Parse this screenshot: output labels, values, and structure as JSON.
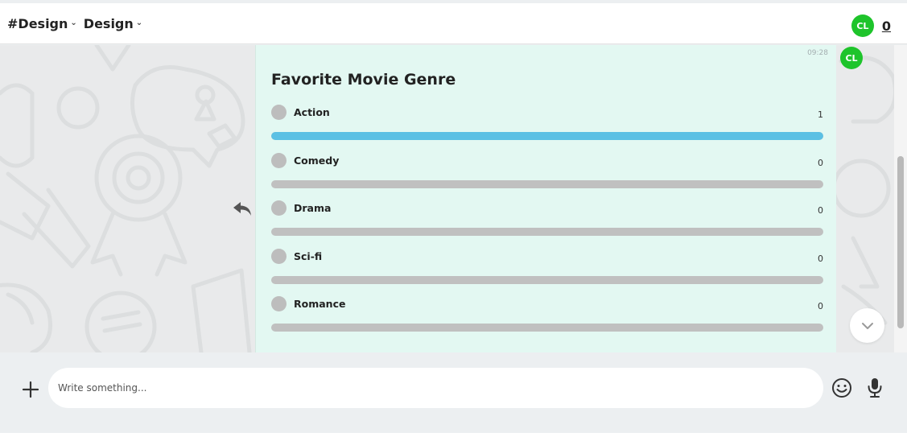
{
  "header": {
    "breadcrumb": [
      {
        "label": "#Design",
        "chevron": "chevron-down-icon"
      },
      {
        "label": "Design",
        "chevron": "chevron-down-icon"
      }
    ],
    "user_initials": "CL",
    "notification_count": "0"
  },
  "message": {
    "time": "09:28",
    "sender_initials": "CL",
    "poll": {
      "title": "Favorite Movie Genre",
      "options": [
        {
          "label": "Action",
          "votes": "1",
          "share": 1.0
        },
        {
          "label": "Comedy",
          "votes": "0",
          "share": 0
        },
        {
          "label": "Drama",
          "votes": "0",
          "share": 0
        },
        {
          "label": "Sci-fi",
          "votes": "0",
          "share": 0
        },
        {
          "label": "Romance",
          "votes": "0",
          "share": 0
        }
      ]
    }
  },
  "composer": {
    "placeholder": "Write something..."
  },
  "colors": {
    "avatar": "#1ec42b",
    "poll_fill": "#5bc0e4",
    "poll_track": "#c0c0c0",
    "bubble": "#e3f8f2"
  },
  "icons": [
    "chevron-down-icon",
    "reply-icon",
    "chevron-down-icon",
    "plus-icon",
    "emoji-icon",
    "microphone-icon"
  ]
}
